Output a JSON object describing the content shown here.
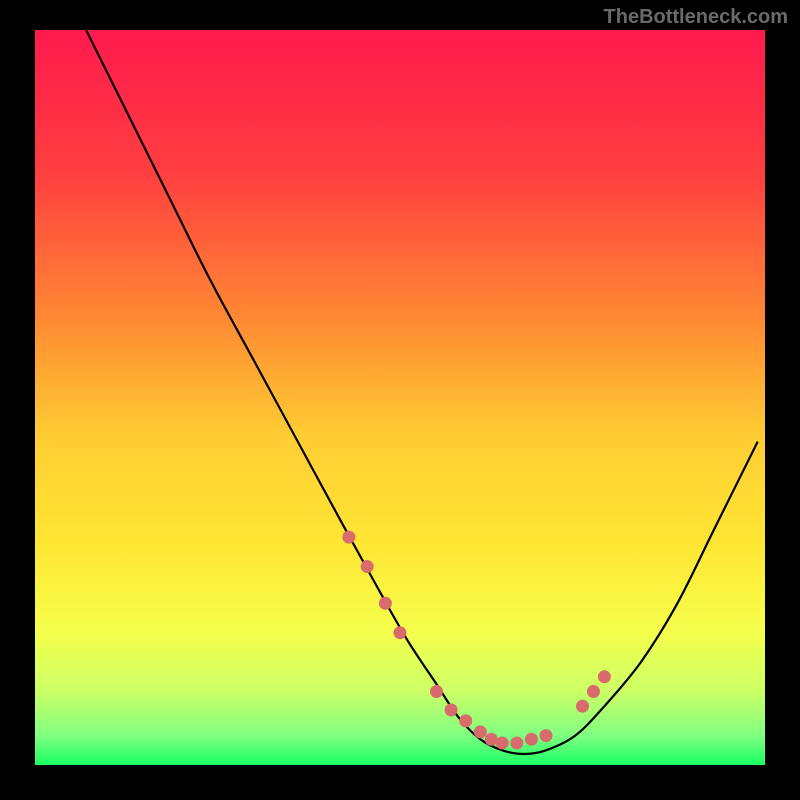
{
  "watermark": "TheBottleneck.com",
  "chart_data": {
    "type": "line",
    "title": "",
    "xlabel": "",
    "ylabel": "",
    "xlim": [
      0,
      100
    ],
    "ylim": [
      0,
      100
    ],
    "gradient_stops": [
      {
        "offset": 0,
        "color": "#ff1a4d"
      },
      {
        "offset": 20,
        "color": "#ff4040"
      },
      {
        "offset": 40,
        "color": "#ff8c33"
      },
      {
        "offset": 55,
        "color": "#ffcc33"
      },
      {
        "offset": 70,
        "color": "#ffe633"
      },
      {
        "offset": 82,
        "color": "#f5ff4d"
      },
      {
        "offset": 90,
        "color": "#ccff66"
      },
      {
        "offset": 96,
        "color": "#80ff80"
      },
      {
        "offset": 100,
        "color": "#1aff66"
      }
    ],
    "series": [
      {
        "name": "curve",
        "x": [
          7,
          12,
          18,
          24,
          30,
          36,
          42,
          47,
          51,
          55,
          58,
          61,
          64,
          67,
          70,
          74,
          78,
          83,
          88,
          93,
          99
        ],
        "y": [
          100,
          90,
          78,
          66,
          55,
          44,
          33,
          24,
          17,
          11,
          6.5,
          3.5,
          2,
          1.5,
          2,
          4,
          8,
          14,
          22,
          32,
          44
        ]
      }
    ],
    "markers": {
      "name": "dots",
      "color": "#d86b6b",
      "x": [
        43,
        45.5,
        48,
        50,
        55,
        57,
        59,
        61,
        62.5,
        64,
        66,
        68,
        70,
        75,
        76.5,
        78
      ],
      "y": [
        31,
        27,
        22,
        18,
        10,
        7.5,
        6,
        4.5,
        3.5,
        3,
        3,
        3.5,
        4,
        8,
        10,
        12
      ]
    }
  }
}
